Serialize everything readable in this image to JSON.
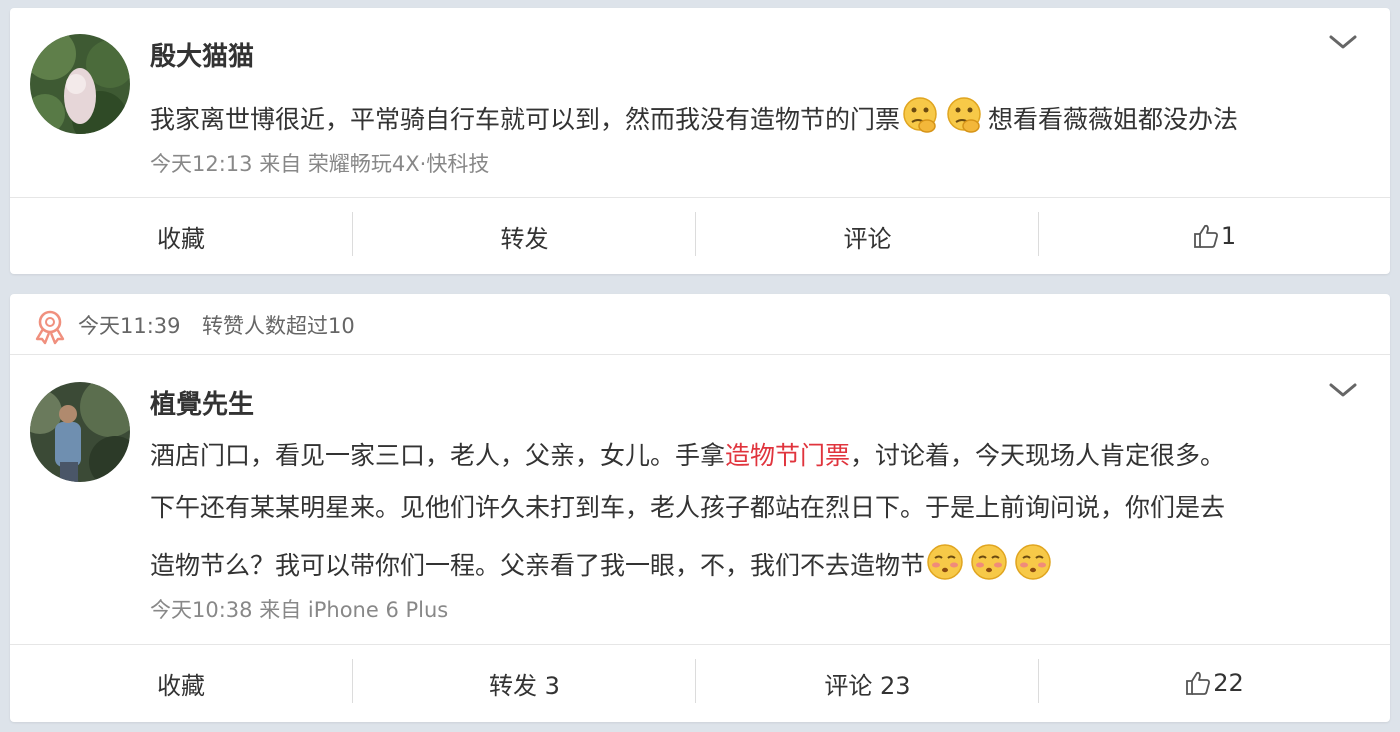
{
  "posts": [
    {
      "author": "殷大猫猫",
      "text_part1": "我家离世博很近，平常骑自行车就可以到，然而我没有造物节的门票",
      "text_part2": "想看看薇薇姐都没办法",
      "emoji_icon": "thinking-face-icon",
      "time": "今天12:13",
      "source": "来自 荣耀畅玩4X·快科技",
      "actions": {
        "collect": "收藏",
        "repost": "转发",
        "comment": "评论",
        "like_count": "1"
      }
    },
    {
      "badge_time": "今天11:39",
      "badge_text": "转赞人数超过10",
      "badge_icon": "award-ribbon-icon",
      "author": "植覺先生",
      "line1_a": "酒店门口，看见一家三口，老人，父亲，女儿。手拿",
      "line1_link": "造物节门票",
      "line1_b": "，讨论着，今天现场人肯定很多。",
      "line2": "下午还有某某明星来。见他们许久未打到车，老人孩子都站在烈日下。于是上前询问说，你们是去",
      "line3": "造物节么？我可以带你们一程。父亲看了我一眼，不，我们不去造物节",
      "emoji_icon": "kissing-face-icon",
      "time": "今天10:38",
      "source": "来自 iPhone 6 Plus",
      "actions": {
        "collect": "收藏",
        "repost": "转发 3",
        "comment": "评论 23",
        "like_count": "22"
      }
    }
  ],
  "colors": {
    "background": "#dde3ea",
    "link_red": "#e0343d",
    "meta_gray": "#888888"
  }
}
